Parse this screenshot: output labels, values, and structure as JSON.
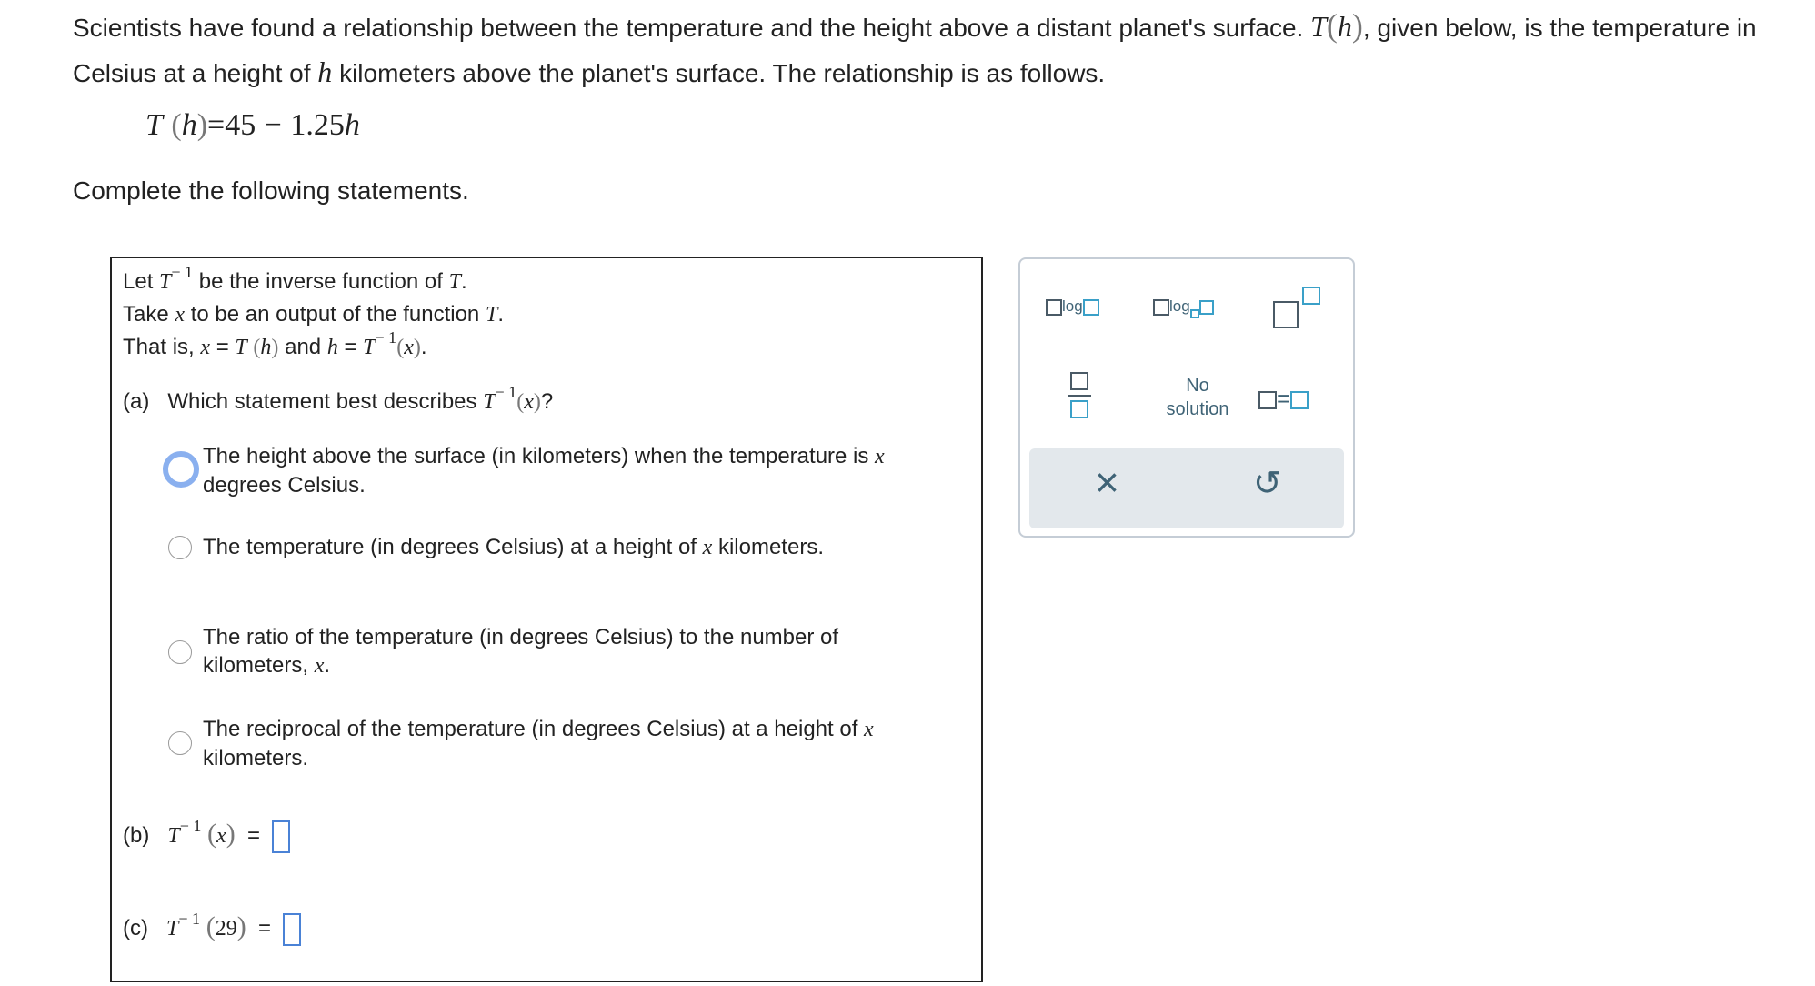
{
  "intro": {
    "p1": "Scientists have found a relationship between the temperature and the height above a distant planet's surface.",
    "T": "T",
    "h": "h",
    "p2": ", given below, is the temperature in Celsius at a height of",
    "p3": "kilometers above the planet's surface. The relationship is as follows."
  },
  "formula": {
    "lhs_T": "T",
    "lhs_h": "h",
    "eq": "=",
    "a": "45",
    "minus": "−",
    "b": "1.25",
    "var": "h"
  },
  "instruction": "Complete the following statements.",
  "box": {
    "line1_a": "Let",
    "T": "T",
    "inv": "− 1",
    "line1_b": "be the inverse function of",
    "line1_end": ".",
    "line2_a": "Take",
    "x": "x",
    "line2_b": "to be an output of the function",
    "line2_end": ".",
    "line3_a": "That is,",
    "line3_eq": "=",
    "line3_and": "and",
    "line3_end": ".",
    "h": "h"
  },
  "part_a": {
    "label": "(a)",
    "question": "Which statement best describes",
    "qmark": "?",
    "options": [
      {
        "text_a": "The height above the surface (in kilometers) when the temperature is",
        "var": "x",
        "text_b": "degrees Celsius."
      },
      {
        "text_a": "The temperature (in degrees Celsius) at a height of",
        "var": "x",
        "text_b": "kilometers."
      },
      {
        "text_a": "The ratio of the temperature (in degrees Celsius) to the number of kilometers,",
        "var": "x",
        "text_b": "."
      },
      {
        "text_a": "The reciprocal of the temperature (in degrees Celsius) at a height of",
        "var": "x",
        "text_b": "kilometers."
      }
    ]
  },
  "part_b": {
    "label": "(b)",
    "arg": "x",
    "eq": "="
  },
  "part_c": {
    "label": "(c)",
    "arg": "29",
    "eq": "="
  },
  "palette": {
    "log": "log",
    "no_solution_1": "No",
    "no_solution_2": "solution",
    "equals": "=",
    "clear": "×",
    "undo": "↺"
  }
}
